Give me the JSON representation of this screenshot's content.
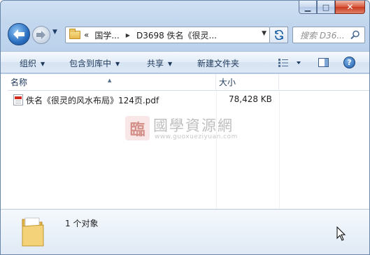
{
  "window": {
    "caption": {
      "minimize_glyph": "▁",
      "maximize_glyph": "□",
      "close_glyph": "✕"
    }
  },
  "nav": {
    "address": {
      "overflow_chevron": "«",
      "crumbs": [
        "国学...",
        "D3698 佚名《很灵..."
      ],
      "separator": "▶"
    },
    "search_placeholder": "搜索 D36..."
  },
  "toolbar": {
    "organize": "组织",
    "include_in_library": "包含到库中",
    "share": "共享",
    "new_folder": "新建文件夹",
    "help": "?"
  },
  "file_list": {
    "columns": {
      "name": "名称",
      "size": "大小"
    },
    "files": [
      {
        "name": "佚名《很灵的风水布局》124页.pdf",
        "size": "78,428 KB",
        "icon": "pdf-file-icon"
      }
    ]
  },
  "watermark": {
    "seal_char": "臨",
    "title": "國學資源網",
    "url": "www.guoxueziyuan.com"
  },
  "details": {
    "item_count": "1 个对象"
  },
  "colors": {
    "chrome_top": "#cfe0f3",
    "command_bar": "#dde8f5",
    "text": "#1e395b",
    "close_button": "#c6391c",
    "accent_blue": "#2a6fc0"
  }
}
